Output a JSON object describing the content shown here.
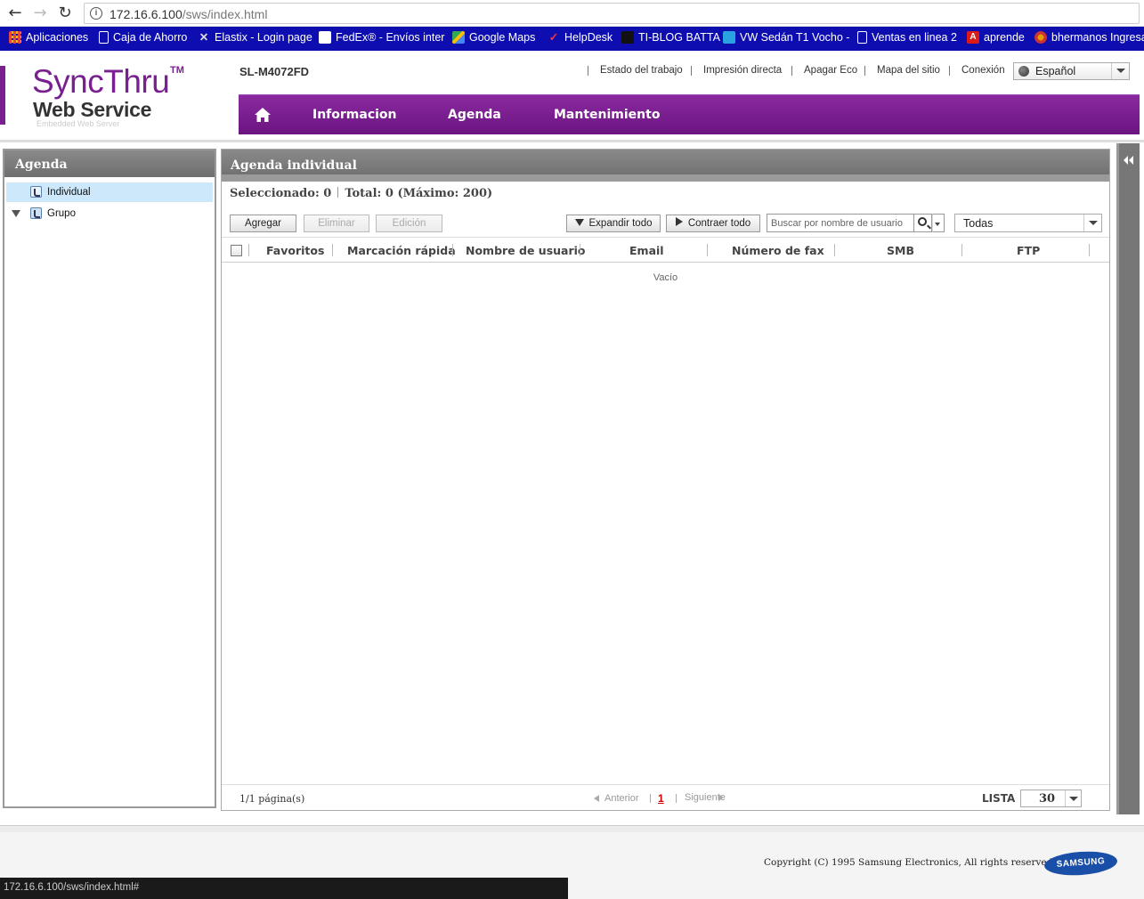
{
  "browser": {
    "back_glyph": "←",
    "forward_glyph": "→",
    "reload_glyph": "↻",
    "url_host": "172.16.6.100",
    "url_path": "/sws/index.html",
    "bookmarks": [
      {
        "label": "Aplicaciones",
        "icon": "apps-grid-icon",
        "color": "#e8453c"
      },
      {
        "label": "Caja de Ahorro",
        "icon": "page-icon",
        "color": "#ffffff"
      },
      {
        "label": "Elastix - Login page",
        "icon": "elastix-icon",
        "color": "#dddddd"
      },
      {
        "label": "FedEx® - Envíos inter",
        "icon": "fedex-icon",
        "color": "#4d148c"
      },
      {
        "label": "Google Maps",
        "icon": "maps-icon",
        "color": "#34a853"
      },
      {
        "label": "HelpDesk",
        "icon": "helpdesk-icon",
        "color": "#d33"
      },
      {
        "label": "TI-BLOG BATTA",
        "icon": "blog-icon",
        "color": "#222"
      },
      {
        "label": "VW Sedán T1 Vocho -",
        "icon": "vw-icon",
        "color": "#2aa1e0"
      },
      {
        "label": "Ventas en linea 2",
        "icon": "page-icon",
        "color": "#ffffff"
      },
      {
        "label": "aprende",
        "icon": "angular-icon",
        "color": "#dd1b16"
      },
      {
        "label": "bhermanos Ingresa",
        "icon": "flower-icon",
        "color": "#e2a000"
      }
    ]
  },
  "header": {
    "logo_main": "SyncThru",
    "logo_tm": "TM",
    "logo_sub": "Web Service",
    "logo_caption": "Embedded Web Server",
    "model": "SL-M4072FD",
    "top_links": [
      "Estado del trabajo",
      "Impresión directa",
      "Apagar Eco",
      "Mapa del sitio",
      "Conexión"
    ],
    "language": "Español"
  },
  "nav": {
    "items": [
      "Informacion",
      "Agenda",
      "Mantenimiento"
    ]
  },
  "sidebar": {
    "title": "Agenda",
    "items": [
      {
        "label": "Individual",
        "selected": true
      },
      {
        "label": "Grupo",
        "expanded": true
      }
    ]
  },
  "main": {
    "title": "Agenda individual",
    "selected_label": "Seleccionado: 0",
    "total_label": "Total: 0 (Máximo: 200)",
    "buttons": {
      "add": "Agregar",
      "delete": "Eliminar",
      "edit": "Edición",
      "expand_all": "Expandir todo",
      "collapse_all": "Contraer todo"
    },
    "search_placeholder": "Buscar por nombre de usuario",
    "filter_value": "Todas",
    "columns": [
      "Favoritos",
      "Marcación rápida",
      "Nombre de usuario",
      "Email",
      "Número de fax",
      "SMB",
      "FTP"
    ],
    "empty_text": "Vacío"
  },
  "pager": {
    "info": "1/1 página(s)",
    "prev": "Anterior",
    "current": "1",
    "next": "Siguiente",
    "list_label": "LISTA",
    "list_value": "30"
  },
  "footer": {
    "copyright": "Copyright (C) 1995 Samsung Electronics, All rights reserved.",
    "brand": "SAMSUNG"
  },
  "status_url": "172.16.6.100/sws/index.html#",
  "colors": {
    "brand_purple": "#7a1f8f",
    "bookmark_bar": "#0d0db0",
    "panel_header": "#7a7a7a",
    "selected_row": "#cde8fb"
  }
}
